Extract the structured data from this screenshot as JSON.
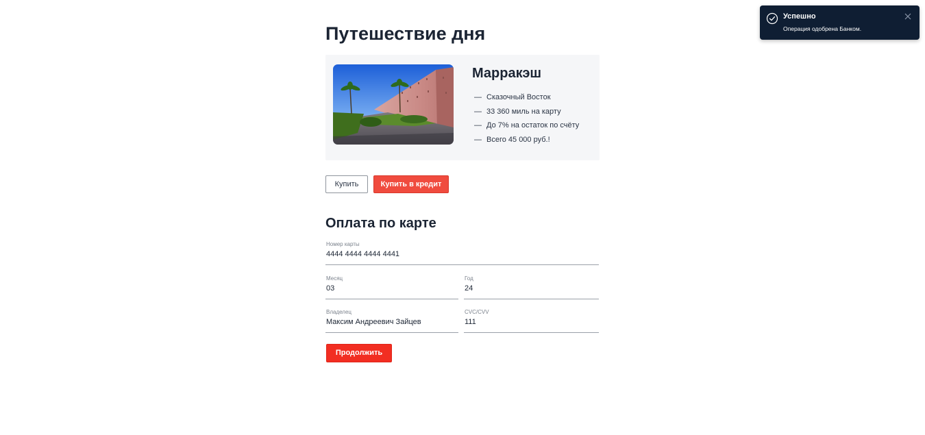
{
  "page": {
    "title": "Путешествие дня"
  },
  "offer": {
    "city": "Марракэш",
    "features": [
      "Сказочный Восток",
      "33 360 миль на карту",
      "До 7% на остаток по счёту",
      "Всего 45 000 руб.!"
    ],
    "image_icon": "city-wall-photo"
  },
  "actions": {
    "buy_label": "Купить",
    "credit_label": "Купить в кредит"
  },
  "payment": {
    "title": "Оплата по карте",
    "card_number": {
      "label": "Номер карты",
      "value": "4444 4444 4444 4441"
    },
    "month": {
      "label": "Месяц",
      "value": "03"
    },
    "year": {
      "label": "Год",
      "value": "24"
    },
    "owner": {
      "label": "Владелец",
      "value": "Максим Андреевич Зайцев"
    },
    "cvc": {
      "label": "CVC/CVV",
      "value": "111"
    },
    "continue_label": "Продолжить"
  },
  "toast": {
    "title": "Успешно",
    "message": "Операция одобрена Банком.",
    "icon": "check-circle-icon",
    "close_icon": "close-icon"
  },
  "colors": {
    "accent": "#f04b3e",
    "primary_button": "#f22e22",
    "toast_bg": "#0f1e33",
    "card_bg": "#f5f6f8",
    "text": "#1b2433"
  }
}
